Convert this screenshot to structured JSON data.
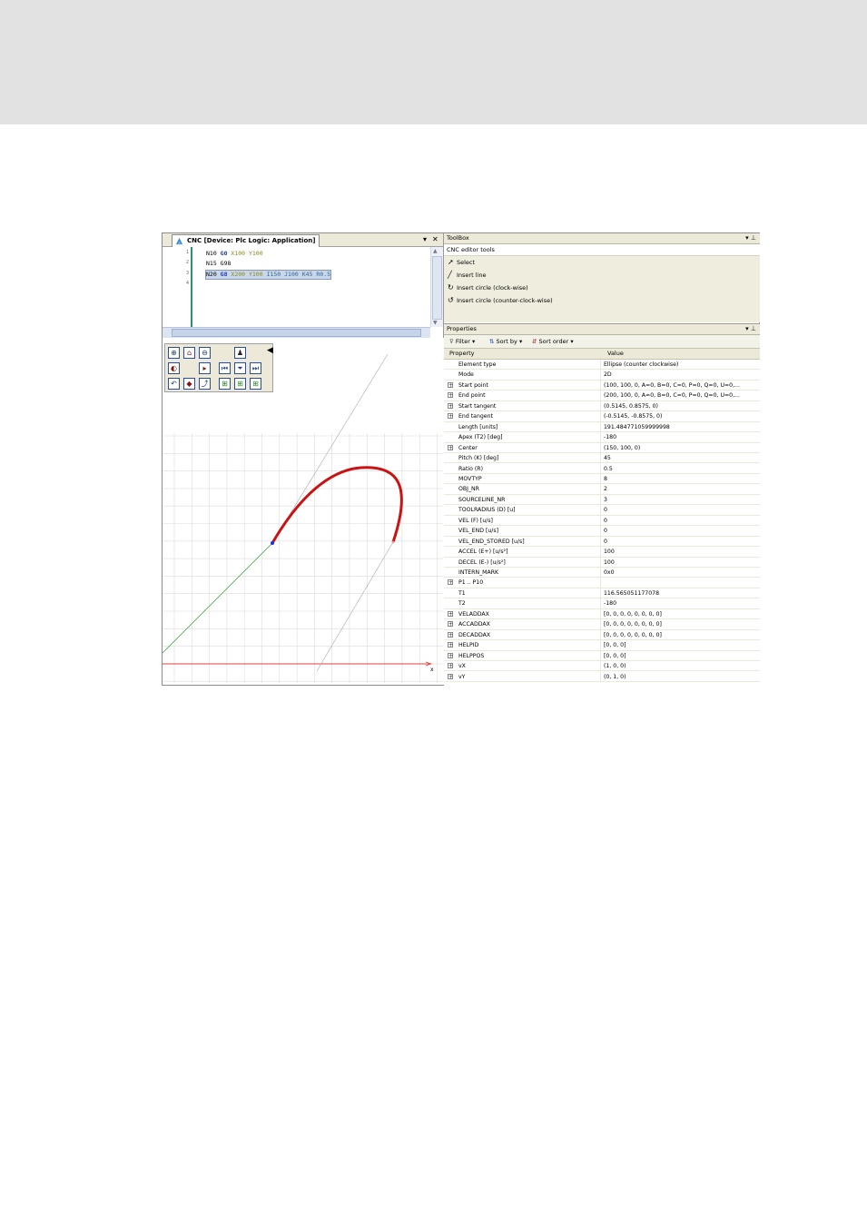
{
  "editor": {
    "tab_title": "CNC [Device: Plc Logic: Application]",
    "line_numbers": [
      "1",
      "2",
      "3",
      "4"
    ],
    "lines": [
      [
        {
          "t": "N10 ",
          "c": "n"
        },
        {
          "t": "G0 ",
          "c": "g"
        },
        {
          "t": "X100 ",
          "c": "c"
        },
        {
          "t": "Y100",
          "c": "c"
        }
      ],
      [
        {
          "t": "N15 ",
          "c": "n"
        },
        {
          "t": "G98",
          "c": "n"
        }
      ],
      [
        {
          "t": "N20 ",
          "c": "n"
        },
        {
          "t": "G8 ",
          "c": "g"
        },
        {
          "t": "X200 ",
          "c": "c"
        },
        {
          "t": "Y100 ",
          "c": "c"
        },
        {
          "t": "I150 ",
          "c": "k"
        },
        {
          "t": "J100 ",
          "c": "k"
        },
        {
          "t": "K45 ",
          "c": "k"
        },
        {
          "t": "R0.5",
          "c": "k"
        }
      ]
    ]
  },
  "canvas": {
    "axis_x_label": "x",
    "zoom_buttons": [
      "zoom-in",
      "home",
      "zoom-out",
      "pawn",
      "fit",
      "",
      "zoom-window",
      "",
      "prev",
      "stop",
      "next",
      "wire",
      "view3d",
      "curve",
      "grid-a",
      "grid-b",
      "grid-c"
    ],
    "arc_color": "#cc1111"
  },
  "toolbox": {
    "title": "ToolBox",
    "section": "CNC editor tools",
    "items": [
      {
        "icon": "arrow-pointer",
        "label": "Select"
      },
      {
        "icon": "line",
        "label": "Insert line"
      },
      {
        "icon": "cw",
        "label": "Insert circle (clock-wise)"
      },
      {
        "icon": "ccw",
        "label": "Insert circle (counter-clock-wise)"
      }
    ]
  },
  "properties": {
    "title": "Properties",
    "filter": "Filter",
    "sort_by": "Sort by",
    "sort_order": "Sort order",
    "col_property": "Property",
    "col_value": "Value",
    "rows": [
      {
        "expand": false,
        "name": "Element type",
        "value": "Ellipse (counter clockwise)"
      },
      {
        "expand": false,
        "name": "Mode",
        "value": "2D"
      },
      {
        "expand": true,
        "name": "Start point",
        "value": "(100, 100, 0, A=0, B=0, C=0, P=0, Q=0, U=0,..."
      },
      {
        "expand": true,
        "name": "End point",
        "value": "(200, 100, 0, A=0, B=0, C=0, P=0, Q=0, U=0,..."
      },
      {
        "expand": true,
        "name": "Start tangent",
        "value": "(0.5145, 0.8575, 0)"
      },
      {
        "expand": true,
        "name": "End tangent",
        "value": "(-0.5145, -0.8575, 0)"
      },
      {
        "expand": false,
        "name": "Length [units]",
        "value": "191.484771059999998"
      },
      {
        "expand": false,
        "name": "Apex (T2) [deg]",
        "value": "-180"
      },
      {
        "expand": true,
        "name": "Center",
        "value": "(150, 100, 0)"
      },
      {
        "expand": false,
        "name": "Pitch (K) [deg]",
        "value": "45"
      },
      {
        "expand": false,
        "name": "Ratio (R)",
        "value": "0.5"
      },
      {
        "expand": false,
        "name": "MOVTYP",
        "value": "8"
      },
      {
        "expand": false,
        "name": "OBJ_NR",
        "value": "2"
      },
      {
        "expand": false,
        "name": "SOURCELINE_NR",
        "value": "3"
      },
      {
        "expand": false,
        "name": "TOOLRADIUS (D) [u]",
        "value": "0"
      },
      {
        "expand": false,
        "name": "VEL (F) [u/s]",
        "value": "0"
      },
      {
        "expand": false,
        "name": "VEL_END [u/s]",
        "value": "0"
      },
      {
        "expand": false,
        "name": "VEL_END_STORED [u/s]",
        "value": "0"
      },
      {
        "expand": false,
        "name": "ACCEL (E+) [u/s²]",
        "value": "100"
      },
      {
        "expand": false,
        "name": "DECEL (E-) [u/s²]",
        "value": "100"
      },
      {
        "expand": false,
        "name": "INTERN_MARK",
        "value": "0x0"
      },
      {
        "expand": true,
        "name": "P1 .. P10",
        "value": ""
      },
      {
        "expand": false,
        "name": "T1",
        "value": "116.565051177078"
      },
      {
        "expand": false,
        "name": "T2",
        "value": "-180"
      },
      {
        "expand": true,
        "name": "VELADDAX",
        "value": "[0, 0, 0, 0, 0, 0, 0, 0]"
      },
      {
        "expand": true,
        "name": "ACCADDAX",
        "value": "[0, 0, 0, 0, 0, 0, 0, 0]"
      },
      {
        "expand": true,
        "name": "DECADDAX",
        "value": "[0, 0, 0, 0, 0, 0, 0, 0]"
      },
      {
        "expand": true,
        "name": "HELPID",
        "value": "[0, 0, 0]"
      },
      {
        "expand": true,
        "name": "HELPPOS",
        "value": "[0, 0, 0]"
      },
      {
        "expand": true,
        "name": "vX",
        "value": "(1, 0, 0)"
      },
      {
        "expand": true,
        "name": "vY",
        "value": "(0, 1, 0)"
      }
    ]
  }
}
